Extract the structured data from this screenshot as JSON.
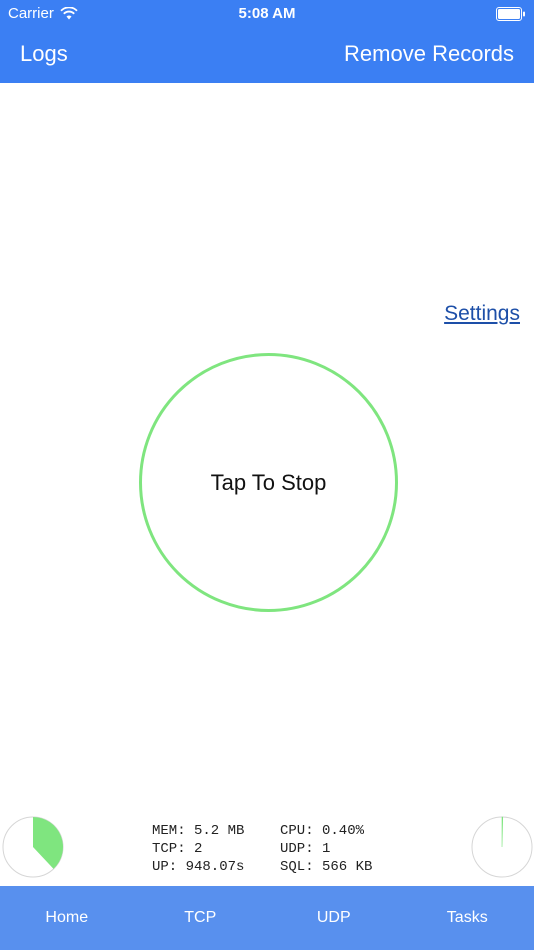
{
  "status_bar": {
    "carrier": "Carrier",
    "time": "5:08 AM"
  },
  "nav": {
    "left_label": "Logs",
    "right_label": "Remove Records"
  },
  "settings_link": "Settings",
  "main_button": {
    "label": "Tap To Stop",
    "ring_color": "#7fe57f"
  },
  "gauges": {
    "memory_fraction": 0.38,
    "cpu_fraction": 0.004,
    "fill_color": "#7fe57f"
  },
  "stats": {
    "mem": "MEM: 5.2 MB",
    "cpu": "CPU: 0.40%",
    "tcp": "TCP: 2",
    "udp": "UDP: 1",
    "up": "UP: 948.07s",
    "sql": "SQL: 566 KB"
  },
  "tabs": [
    {
      "label": "Home"
    },
    {
      "label": "TCP"
    },
    {
      "label": "UDP"
    },
    {
      "label": "Tasks"
    }
  ],
  "colors": {
    "header": "#3b7ff3",
    "tab_bar": "#5890ee",
    "link": "#1d4fa8"
  }
}
